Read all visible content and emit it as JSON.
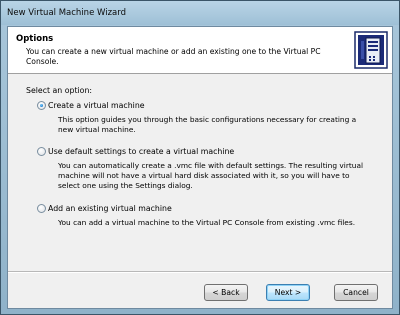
{
  "window": {
    "title": "New Virtual Machine Wizard"
  },
  "header": {
    "title": "Options",
    "description": "You can create a new virtual machine or add an existing one to the Virtual PC Console.",
    "icon": "server-computer-icon"
  },
  "prompt": "Select an option:",
  "options": [
    {
      "label": "Create a virtual machine",
      "description": "This option guides you through the basic configurations necessary for creating a new virtual machine.",
      "selected": true
    },
    {
      "label": "Use default settings to create a virtual machine",
      "description": "You can automatically create a .vmc file with default settings. The resulting virtual machine will not have a virtual hard disk associated with it, so you will have to select one using the Settings dialog.",
      "selected": false
    },
    {
      "label": "Add an existing virtual machine",
      "description": "You can add a virtual machine to the Virtual PC Console from existing .vmc files.",
      "selected": false
    }
  ],
  "buttons": {
    "back": "< Back",
    "next": "Next >",
    "cancel": "Cancel"
  },
  "colors": {
    "selected_radio": "#1f7fd0",
    "next_button_border": "#3c7fb1"
  }
}
